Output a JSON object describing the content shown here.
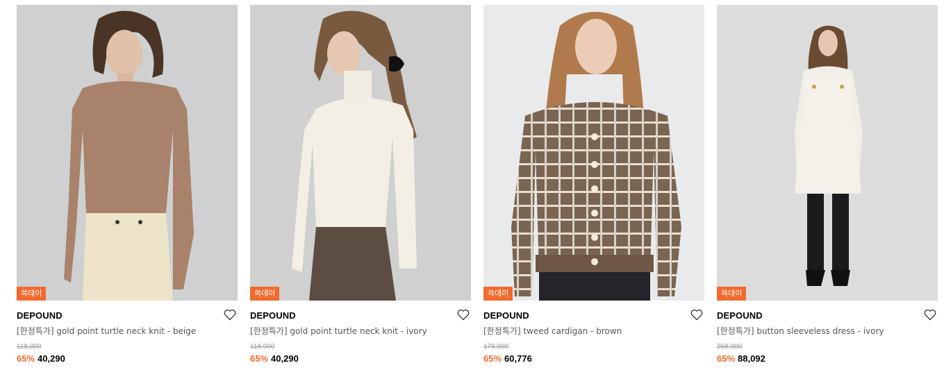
{
  "colors": {
    "accent": "#f26a2e",
    "badge": "#f26a2e"
  },
  "products": [
    {
      "badge": "쓱데이",
      "brand": "DEPOUND",
      "name": "[한정특가] gold point turtle neck knit - beige",
      "original_price": "118,000",
      "discount": "65%",
      "price": "40,290",
      "icon": "heart-icon"
    },
    {
      "badge": "쓱데이",
      "brand": "DEPOUND",
      "name": "[한정특가] gold point turtle neck knit - ivory",
      "original_price": "118,000",
      "discount": "65%",
      "price": "40,290",
      "icon": "heart-icon"
    },
    {
      "badge": "쓱데이",
      "brand": "DEPOUND",
      "name": "[한정특가] tweed cardigan - brown",
      "original_price": "178,000",
      "discount": "65%",
      "price": "60,776",
      "icon": "heart-icon"
    },
    {
      "badge": "쓱데이",
      "brand": "DEPOUND",
      "name": "[한정특가] button sleeveless dress - ivory",
      "original_price": "258,000",
      "discount": "65%",
      "price": "88,092",
      "icon": "heart-icon"
    }
  ]
}
